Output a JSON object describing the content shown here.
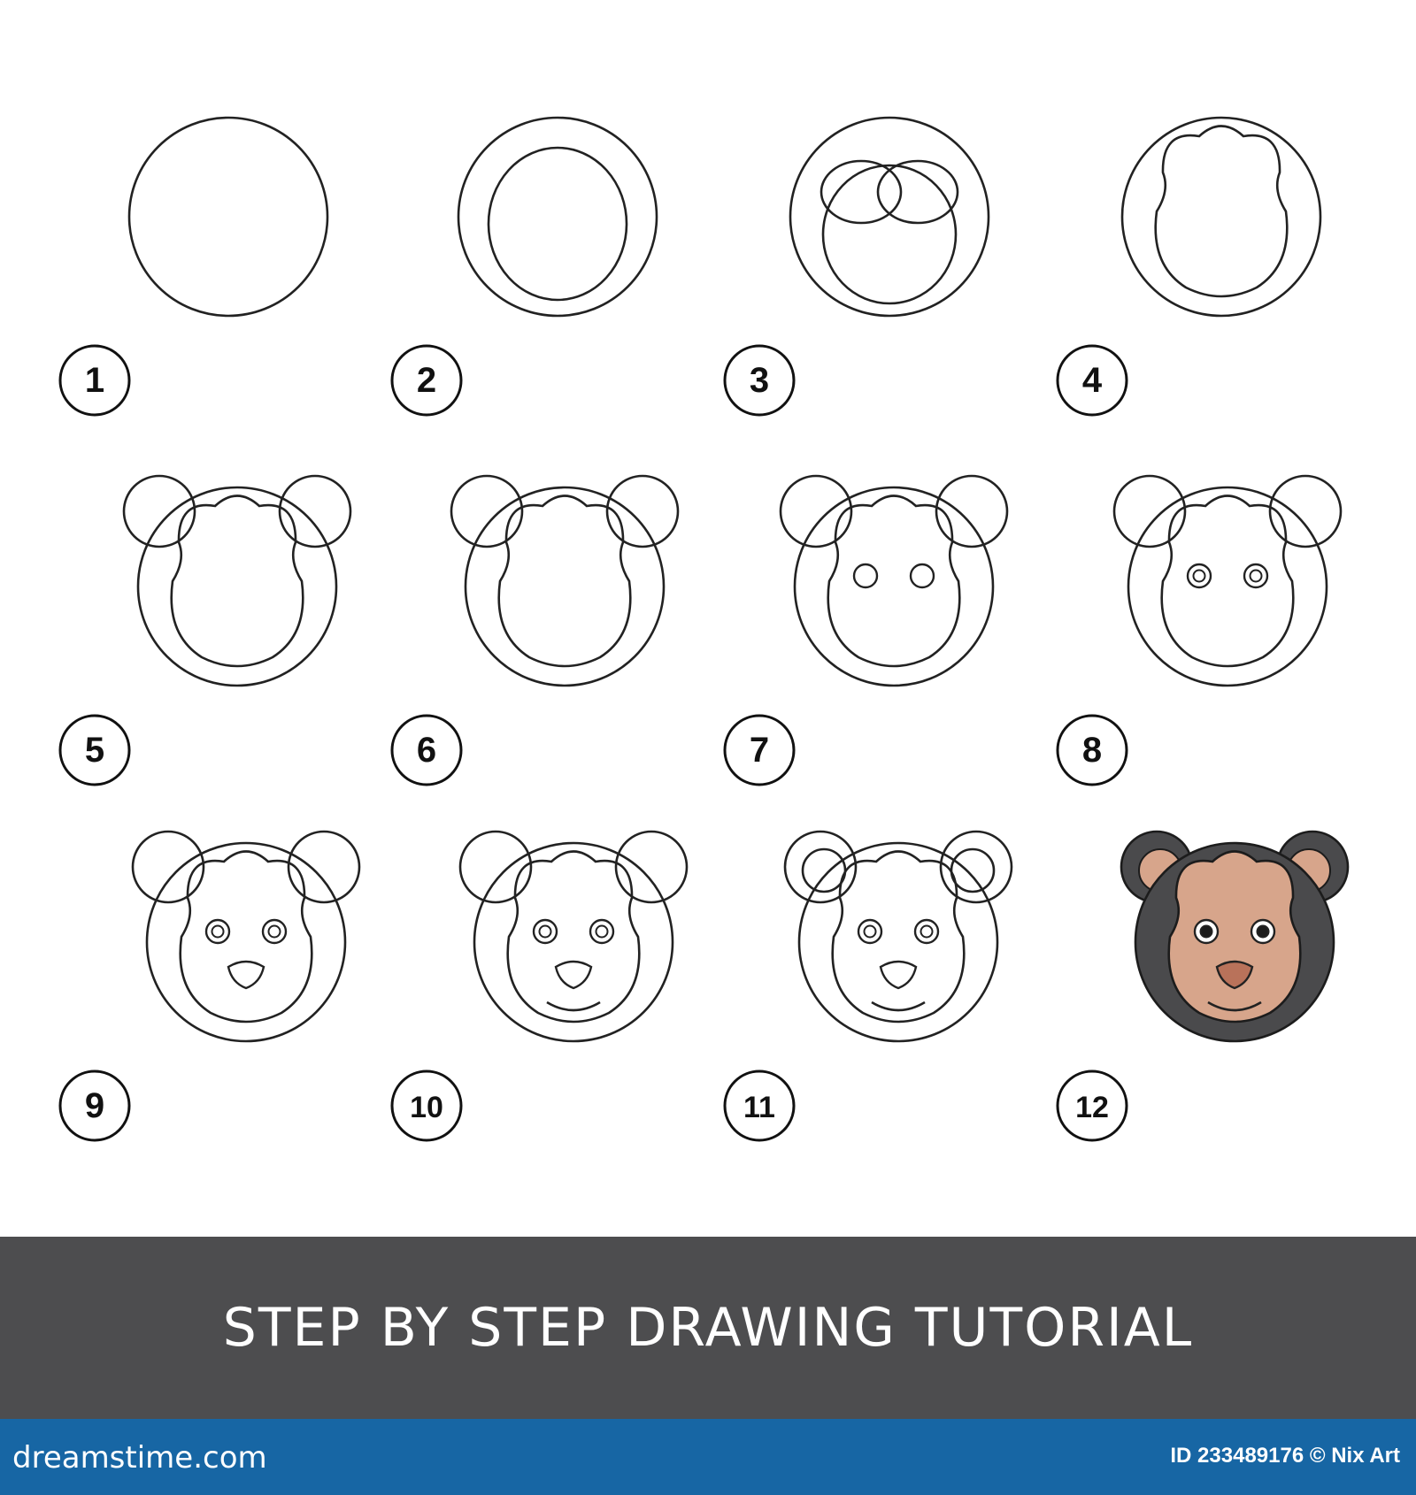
{
  "title": "STEP BY STEP DRAWING TUTORIAL",
  "steps": [
    "1",
    "2",
    "3",
    "4",
    "5",
    "6",
    "7",
    "8",
    "9",
    "10",
    "11",
    "12"
  ],
  "footer": {
    "brand": "dreamstime.com",
    "id_text": "ID 233489176 © Nix Art"
  },
  "colors": {
    "line": "#222222",
    "banner": "#4d4d4f",
    "footer": "#1766a4",
    "fur": "#4a4a4c",
    "face": "#d7a58b",
    "nose": "#b9725a"
  }
}
